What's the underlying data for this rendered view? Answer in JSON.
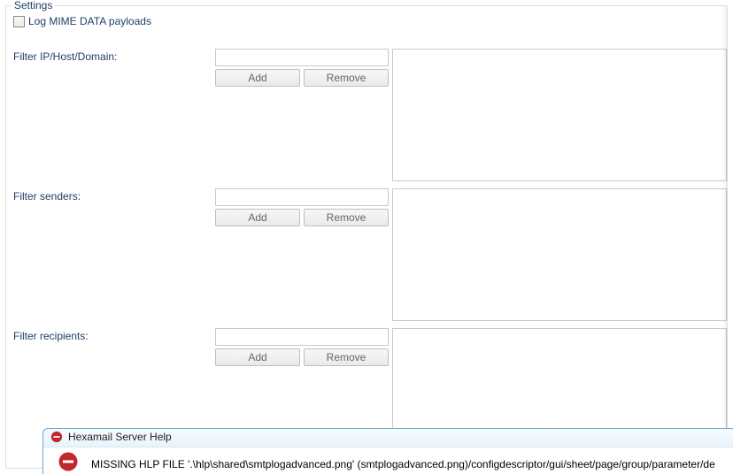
{
  "group": {
    "title": "Settings"
  },
  "logMime": {
    "label": "Log MIME DATA payloads",
    "checked": false
  },
  "filterHost": {
    "label": "Filter IP/Host/Domain:",
    "value": "",
    "addLabel": "Add",
    "removeLabel": "Remove",
    "items": []
  },
  "filterSenders": {
    "label": "Filter senders:",
    "value": "",
    "addLabel": "Add",
    "removeLabel": "Remove",
    "items": []
  },
  "filterRecipients": {
    "label": "Filter recipients:",
    "value": "",
    "addLabel": "Add",
    "removeLabel": "Remove",
    "items": []
  },
  "help": {
    "title": "Hexamail Server Help",
    "message": "MISSING HLP FILE '.\\hlp\\shared\\smtplogadvanced.png' (smtplogadvanced.png)/configdescriptor/gui/sheet/page/group/parameter/de"
  }
}
